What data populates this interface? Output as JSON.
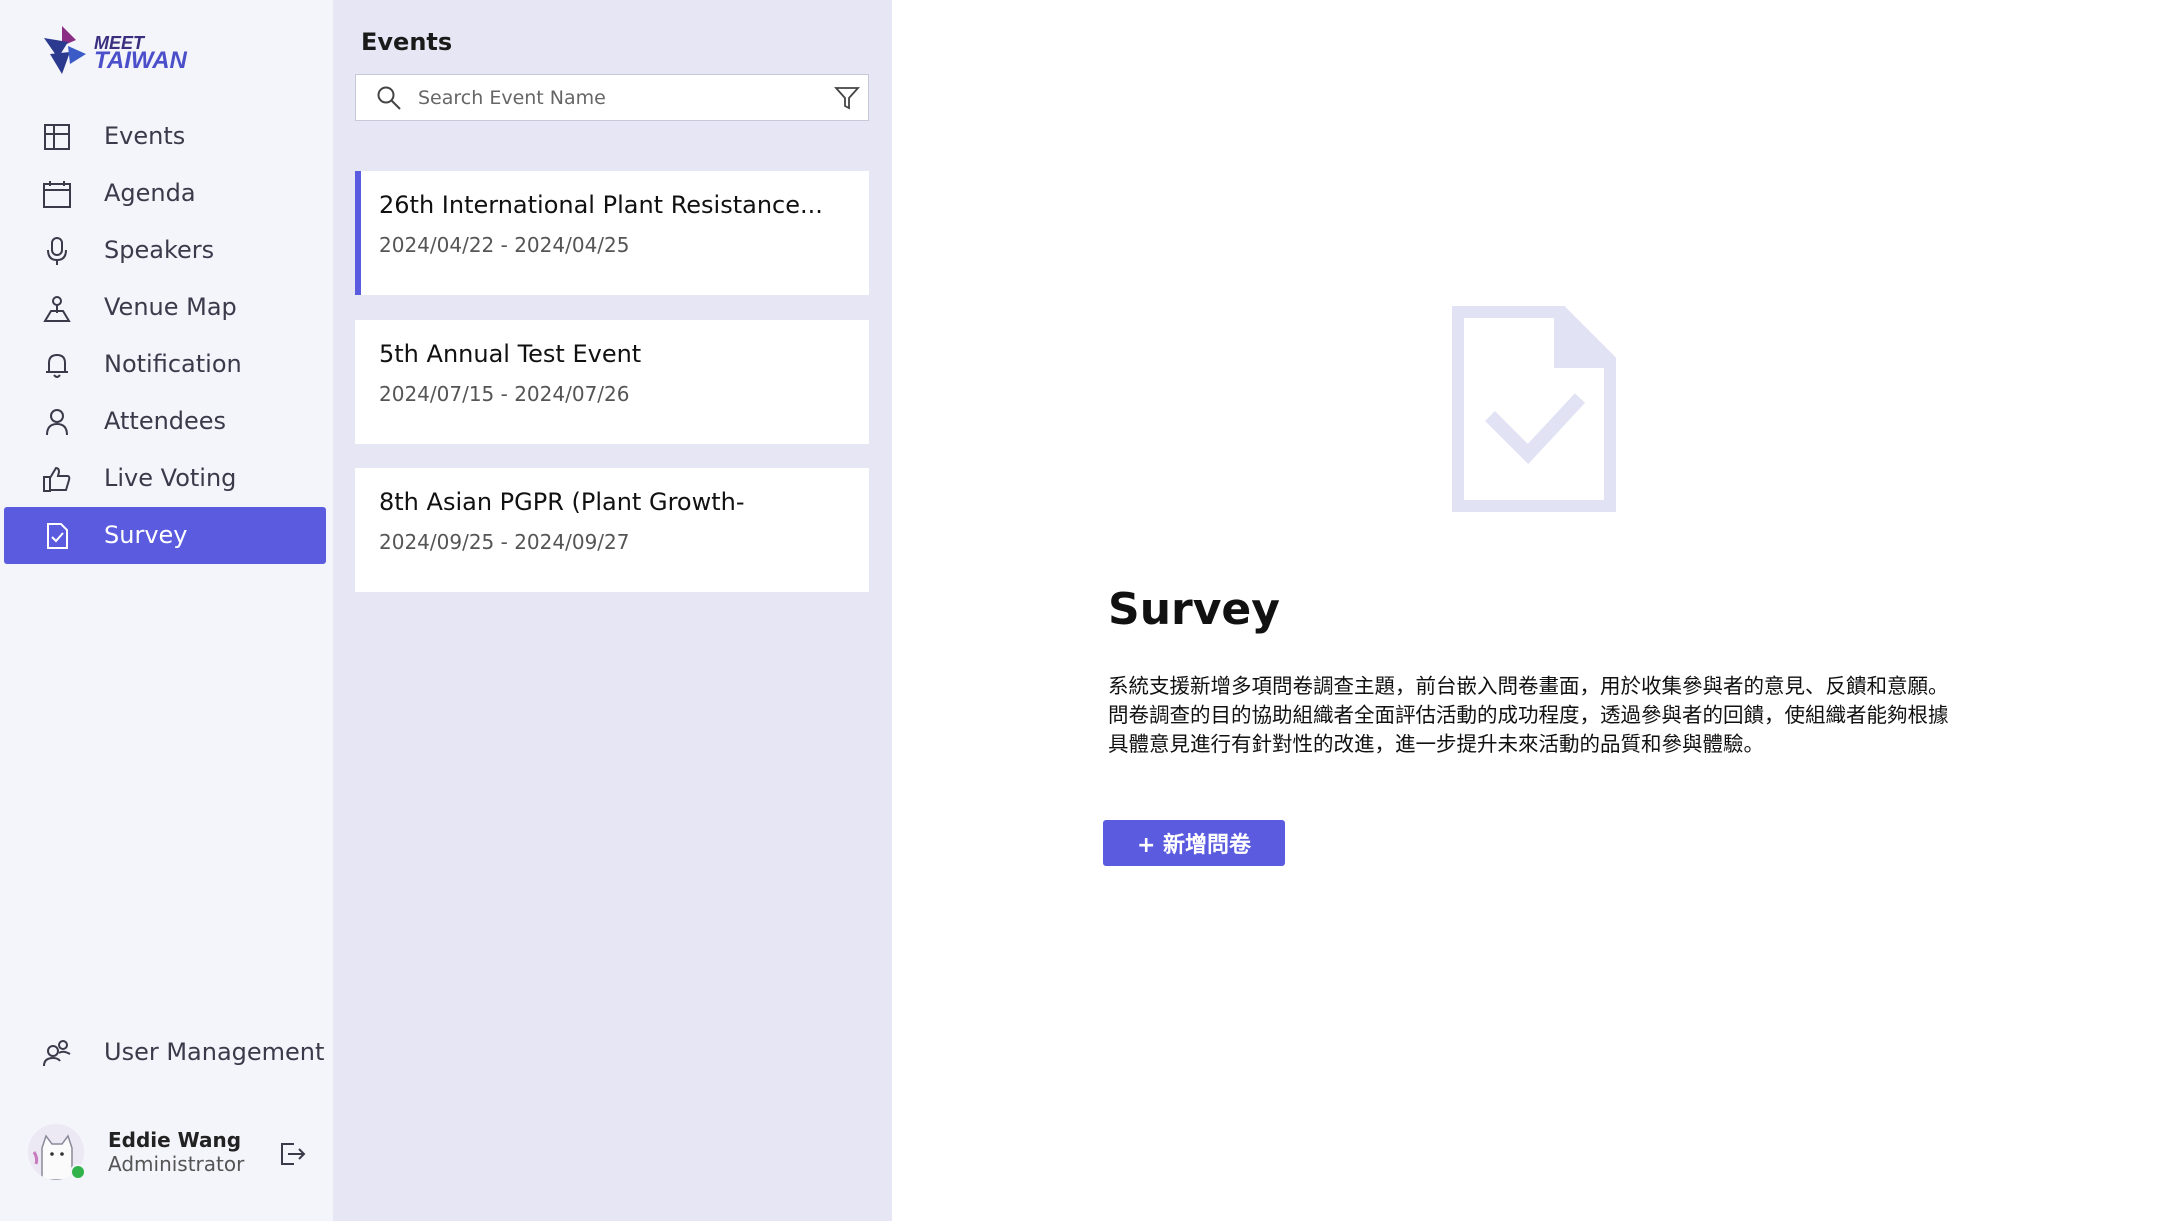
{
  "app": {
    "logo_line1": "MEET",
    "logo_line2": "TAIWAN",
    "accent_color": "#5b5be0",
    "sidebar_bg": "#f4f4fb",
    "events_panel_bg": "#e6e6f5",
    "online_status_color": "#31b24a"
  },
  "sidebar": {
    "items": [
      {
        "label": "Events",
        "icon": "layout-grid-icon"
      },
      {
        "label": "Agenda",
        "icon": "calendar-icon"
      },
      {
        "label": "Speakers",
        "icon": "microphone-icon"
      },
      {
        "label": "Venue Map",
        "icon": "map-pin-icon"
      },
      {
        "label": "Notification",
        "icon": "bell-icon"
      },
      {
        "label": "Attendees",
        "icon": "person-icon"
      },
      {
        "label": "Live Voting",
        "icon": "thumbs-up-icon"
      },
      {
        "label": "Survey",
        "icon": "document-check-icon",
        "active": true
      }
    ],
    "user_management": {
      "label": "User Management",
      "icon": "users-icon"
    },
    "user": {
      "name": "Eddie Wang",
      "role": "Administrator"
    }
  },
  "events_panel": {
    "title": "Events",
    "search": {
      "placeholder": "Search Event Name",
      "value": ""
    },
    "events": [
      {
        "name": "26th International Plant Resistance...",
        "dates": "2024/04/22 - 2024/04/25",
        "selected": true
      },
      {
        "name": "5th Annual Test Event",
        "dates": "2024/07/15 - 2024/07/26"
      },
      {
        "name": "8th Asian PGPR (Plant Growth-",
        "dates": "2024/09/25 - 2024/09/27"
      }
    ]
  },
  "main": {
    "title": "Survey",
    "description": "系統支援新增多項問卷調查主題，前台嵌入問卷畫面，用於收集參與者的意見、反饋和意願。問卷調查的目的協助組織者全面評估活動的成功程度，透過參與者的回饋，使組織者能夠根據具體意見進行有針對性的改進，進一步提升未來活動的品質和參與體驗。",
    "add_button": "+ 新增問卷"
  }
}
